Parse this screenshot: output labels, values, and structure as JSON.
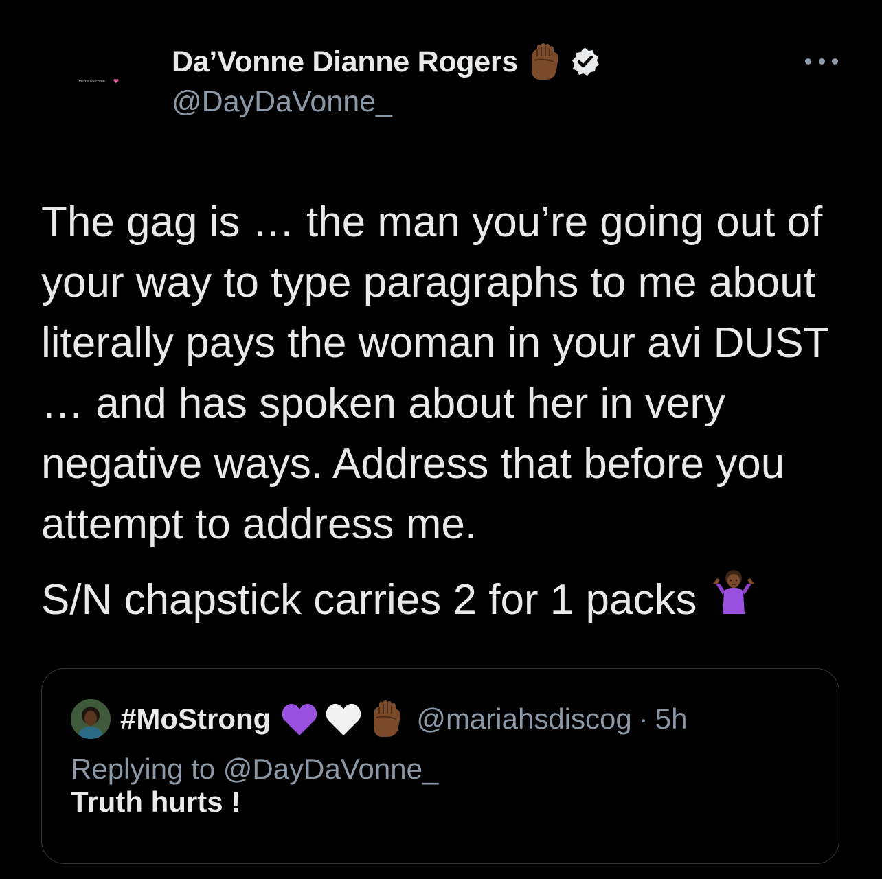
{
  "author": {
    "display_name": "Da’Vonne Dianne Rogers",
    "handle": "@DayDaVonne_",
    "avatar_caption": "You're welcome",
    "name_emoji": "raised-fist-medium-dark-skin",
    "verified": true
  },
  "tweet": {
    "body": "The gag is … the man you’re going out of your way to type paragraphs to me about literally pays the woman in your avi DUST … and has spoken about her in very negative ways. Address that before you attempt to address me.",
    "sn_line": "S/N chapstick carries 2 for 1 packs",
    "sn_emoji": "person-shrugging-medium-dark-skin"
  },
  "quoted_tweet": {
    "display_name": "#MoStrong",
    "name_emojis": [
      "purple-heart",
      "white-heart",
      "raised-fist-medium-dark-skin"
    ],
    "handle": "@mariahsdiscog",
    "separator": "·",
    "time": "5h",
    "replying_to": "Replying to @DayDaVonne_",
    "text": "Truth hurts !"
  },
  "colors": {
    "background": "#000000",
    "text_primary": "#e7e9ea",
    "text_secondary": "#8b98a5",
    "border": "#333639",
    "purple_heart": "#9b51e0",
    "skin_tone": "#7a4a2a"
  }
}
